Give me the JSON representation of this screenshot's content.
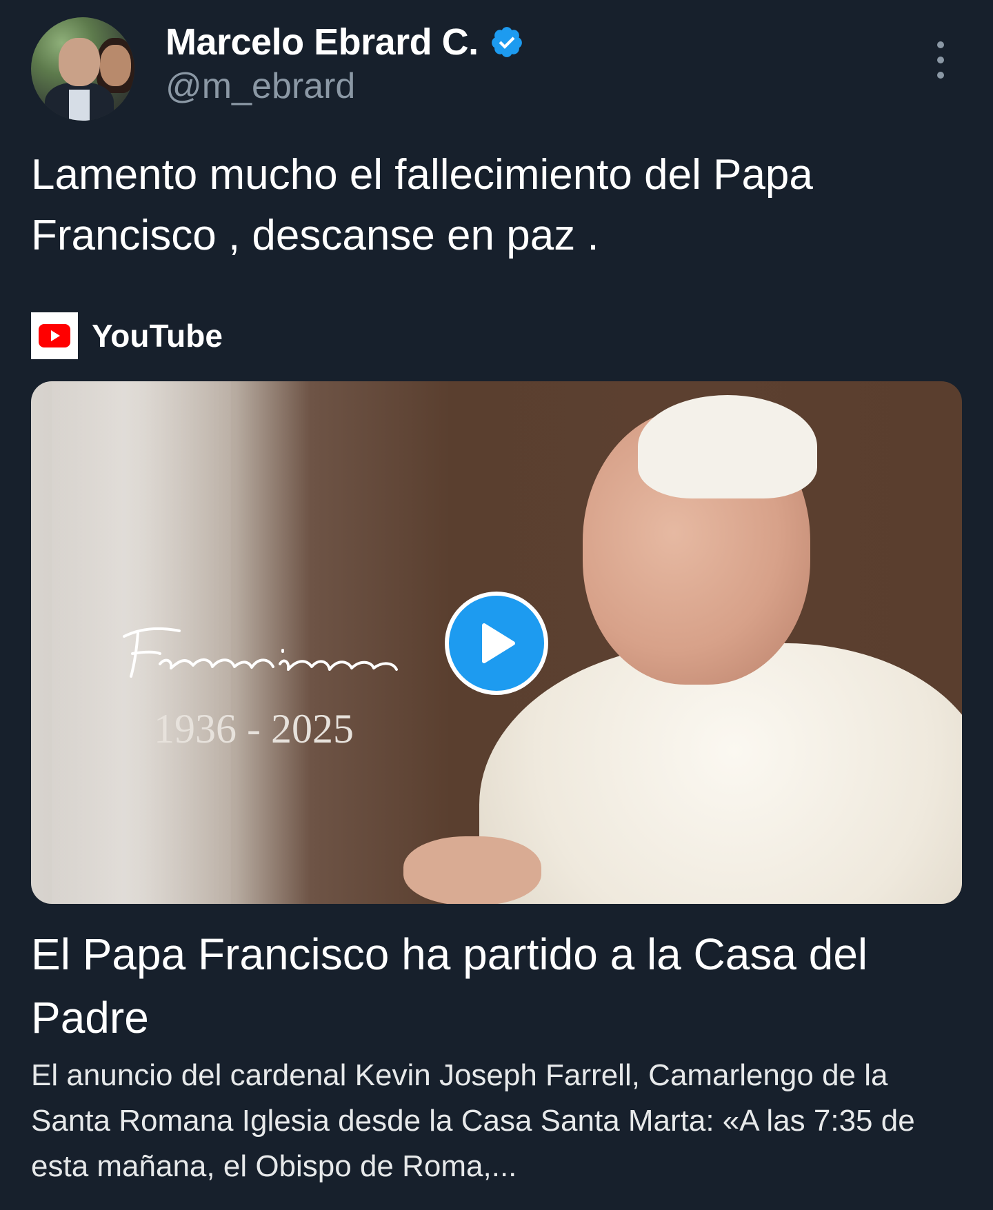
{
  "author": {
    "display_name": "Marcelo Ebrard C.",
    "handle": "@m_ebrard",
    "verified": true,
    "verified_color": "#1d9bf0"
  },
  "tweet": {
    "text": "Lamento mucho el fallecimiento del Papa Francisco , descanse en paz ."
  },
  "link_card": {
    "source": "YouTube",
    "source_icon": "youtube-logo-icon",
    "thumbnail": {
      "signature": "Franciscus",
      "years": "1936 - 2025",
      "play_icon": "play-icon"
    },
    "title": "El Papa Francisco ha partido a la Casa del Padre",
    "description": "El anuncio del cardenal Kevin Joseph Farrell, Camarlengo de la Santa Romana Iglesia desde la Casa Santa Marta: «A las 7:35 de esta mañana, el Obispo de Roma,..."
  },
  "colors": {
    "background": "#17202c",
    "text": "#ffffff",
    "secondary_text": "#8b98a5",
    "accent": "#1d9bf0",
    "youtube_red": "#ff0000"
  }
}
